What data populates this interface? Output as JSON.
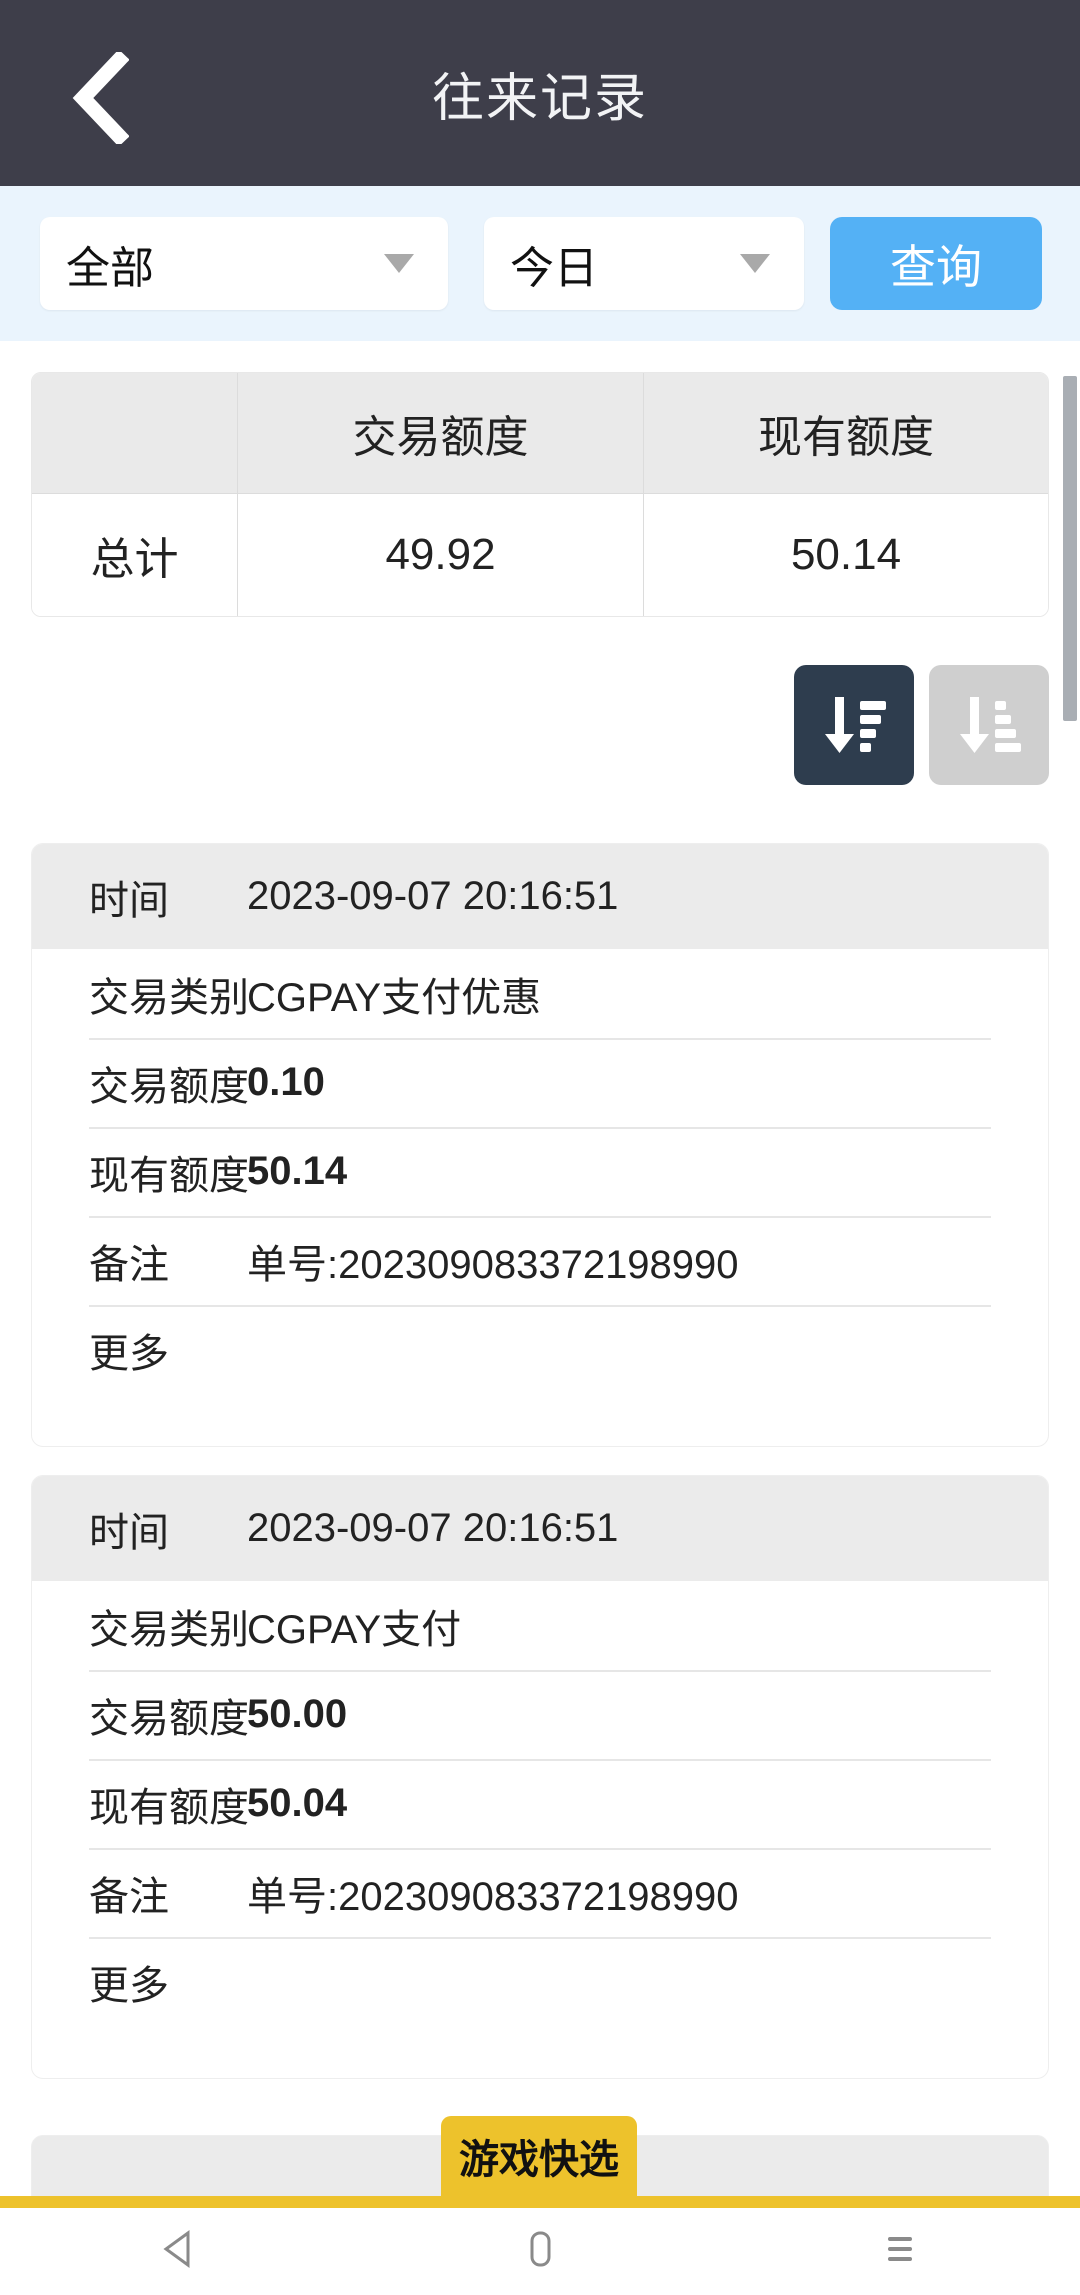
{
  "header": {
    "title": "往来记录",
    "back_icon": "chevron-left-icon",
    "bg_color": "#3e3e4a"
  },
  "filter": {
    "type_select": {
      "value": "全部",
      "caret_icon": "caret-down-icon"
    },
    "date_select": {
      "value": "今日",
      "caret_icon": "caret-down-icon"
    },
    "query_button": {
      "label": "查询",
      "color": "#54b1f5"
    }
  },
  "summary": {
    "columns": [
      "",
      "交易额度",
      "现有额度"
    ],
    "row_label": "总计",
    "values": [
      "49.92",
      "50.14"
    ]
  },
  "sort": {
    "descending": {
      "icon": "sort-descending-icon",
      "active": true,
      "color": "#2e3d4e"
    },
    "ascending": {
      "icon": "sort-ascending-icon",
      "active": false,
      "color": "#cfcfcf"
    }
  },
  "records": [
    {
      "time_label": "时间",
      "time_value": "2023-09-07 20:16:51",
      "type_label": "交易类别",
      "type_value": "CGPAY支付优惠",
      "amount_label": "交易额度",
      "amount_value": "0.10",
      "balance_label": "现有额度",
      "balance_value": "50.14",
      "note_label": "备注",
      "note_value": "单号:202309083372198990",
      "more_label": "更多"
    },
    {
      "time_label": "时间",
      "time_value": "2023-09-07 20:16:51",
      "type_label": "交易类别",
      "type_value": "CGPAY支付",
      "amount_label": "交易额度",
      "amount_value": "50.00",
      "balance_label": "现有额度",
      "balance_value": "50.04",
      "note_label": "备注",
      "note_value": "单号:202309083372198990",
      "more_label": "更多"
    }
  ],
  "game_badge": {
    "label": "游戏快选",
    "color": "#edc22c"
  },
  "navbar": {
    "back": "nav-back-icon",
    "home": "nav-home-icon",
    "recents": "nav-recents-icon"
  }
}
